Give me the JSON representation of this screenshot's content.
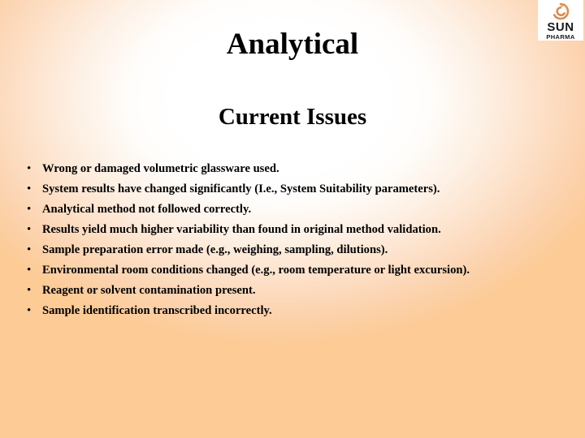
{
  "slide": {
    "title": "Analytical",
    "subtitle": "Current Issues",
    "background": {
      "center_color": "#ffffff",
      "edge_color": "#fccb96"
    },
    "bullet_marker": "•",
    "bullets": [
      {
        "text": "Wrong or damaged volumetric glassware used.",
        "justified": false
      },
      {
        "text": "System results have changed significantly (I.e., System Suitability parameters).",
        "justified": true
      },
      {
        "text": "Analytical method not followed correctly.",
        "justified": false
      },
      {
        "text": "Results yield much higher variability than found in original method validation.",
        "justified": true
      },
      {
        "text": "Sample preparation error made (e.g., weighing, sampling, dilutions).",
        "justified": false
      },
      {
        "text": "Environmental room conditions changed (e.g., room temperature or light excursion).",
        "justified": true
      },
      {
        "text": "Reagent or solvent contamination present.",
        "justified": false
      },
      {
        "text": "Sample identification transcribed incorrectly.",
        "justified": false
      }
    ]
  },
  "logo": {
    "name": "sun-pharma-logo",
    "wordmark_primary": "SUN",
    "wordmark_secondary": "PHARMA",
    "mark_color": "#d98a4e",
    "text_color": "#1a1a1a"
  }
}
